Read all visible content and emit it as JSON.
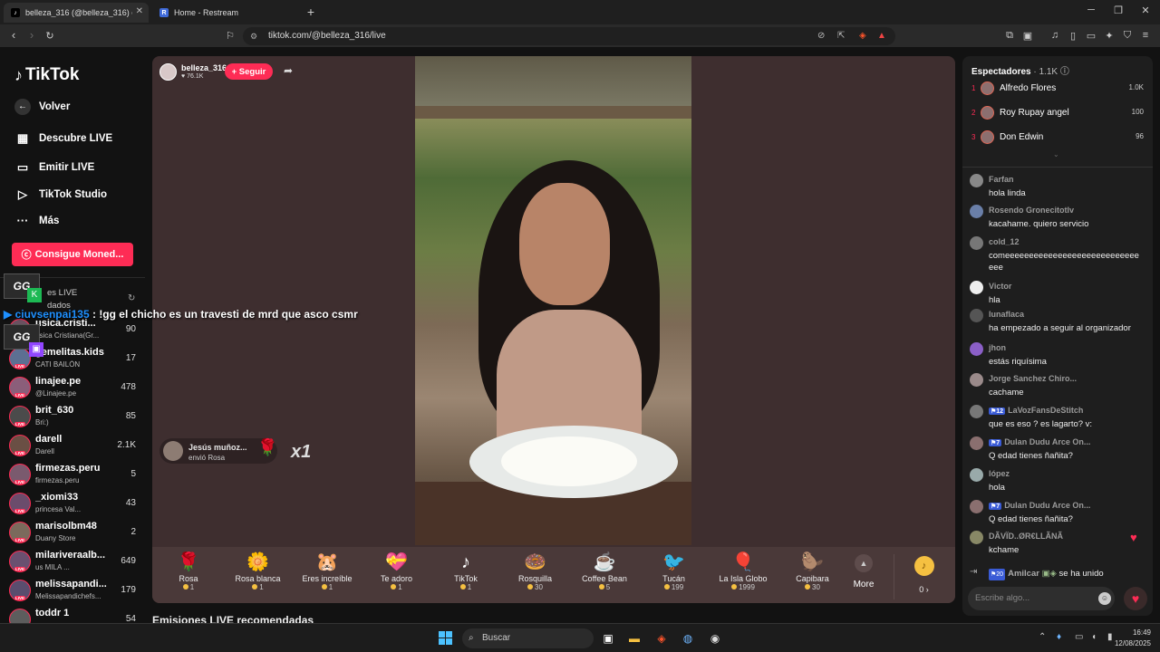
{
  "browser": {
    "tabs": [
      {
        "title": "belleza_316 (@belleza_316) e",
        "active": true
      },
      {
        "title": "Home - Restream",
        "active": false
      }
    ],
    "url": "tiktok.com/@belleza_316/live"
  },
  "nav": {
    "logo": "TikTok",
    "back": "Volver",
    "items": [
      "Descubre LIVE",
      "Emitir LIVE",
      "TikTok Studio",
      "Más"
    ],
    "coins_button": "Consigue Moned...",
    "section_title_partial": "es LIVE",
    "section_sub_partial": "dados"
  },
  "channels": [
    {
      "name": "usica.cristi...",
      "sub": "usica Cristiana(Gr...",
      "count": "90"
    },
    {
      "name": "gemelitas.kids",
      "sub": "CATI BAILÓN",
      "count": "17"
    },
    {
      "name": "linajee.pe",
      "sub": "@Linajee.pe",
      "count": "478"
    },
    {
      "name": "brit_630",
      "sub": "Bri:)",
      "count": "85"
    },
    {
      "name": "darell",
      "sub": "Darell",
      "count": "2.1K"
    },
    {
      "name": "firmezas.peru",
      "sub": "firmezas.peru",
      "count": "5"
    },
    {
      "name": "_xiomi33",
      "sub": "princesa Val...",
      "count": "43"
    },
    {
      "name": "marisolbm48",
      "sub": "Duany Store",
      "count": "2"
    },
    {
      "name": "milariveraalb...",
      "sub": "us MILA ...",
      "count": "649"
    },
    {
      "name": "melissapandi...",
      "sub": "Melissapandichefs...",
      "count": "179"
    },
    {
      "name": "toddr 1",
      "sub": "",
      "count": "54"
    }
  ],
  "live_badge": "LIVE",
  "streamer": {
    "name": "belleza_316",
    "likes": "76.1K",
    "follow": "+ Seguir"
  },
  "gift_notice": {
    "user": "Jesús muñoz...",
    "text": "envió Rosa",
    "multiplier": "x1"
  },
  "overlay": {
    "badge": "GG",
    "username": "ciuvsenpai135",
    "message": ": !gg el chicho es un travesti de mrd que asco csmr"
  },
  "gifts": [
    {
      "name": "Rosa",
      "price": "1",
      "icon": "🌹"
    },
    {
      "name": "Rosa blanca",
      "price": "1",
      "icon": "🌼"
    },
    {
      "name": "Eres increíble",
      "price": "1",
      "icon": "🐹"
    },
    {
      "name": "Te adoro",
      "price": "1",
      "icon": "💝"
    },
    {
      "name": "TikTok",
      "price": "1",
      "icon": "♪"
    },
    {
      "name": "Rosquilla",
      "price": "30",
      "icon": "🍩"
    },
    {
      "name": "Coffee Bean",
      "price": "5",
      "icon": "☕"
    },
    {
      "name": "Tucán",
      "price": "199",
      "icon": "🐦"
    },
    {
      "name": "La Isla Globo",
      "price": "1999",
      "icon": "🎈"
    },
    {
      "name": "Capibara",
      "price": "30",
      "icon": "🦫"
    }
  ],
  "more": "More",
  "coin_balance": "0 ›",
  "recommended": "Emisiones LIVE recomendadas",
  "viewers": {
    "title": "Espectadores",
    "count": "· 1.1K",
    "top": [
      {
        "rank": "1",
        "name": "Alfredo Flores",
        "score": "1.0K"
      },
      {
        "rank": "2",
        "name": "Roy Rupay angel",
        "score": "100"
      },
      {
        "rank": "3",
        "name": "Don Edwin",
        "score": "96"
      }
    ]
  },
  "comments": [
    {
      "user": "Farfan",
      "text": "hola linda"
    },
    {
      "user": "Rosendo Gronecitotlv",
      "text": "kacahame. quiero servicio"
    },
    {
      "user": "cold_12",
      "text": "comeeeeeeeeeeeeeeeeeeeeeeeeeeee eee"
    },
    {
      "user": "Victor",
      "text": "hla"
    },
    {
      "user": "lunaflaca",
      "text": "ha empezado a seguir al organizador"
    },
    {
      "user": "jhon",
      "text": "estás riquísima"
    },
    {
      "user": "Jorge Sanchez Chiro...",
      "text": "cachame"
    },
    {
      "user": "LaVozFansDeStitch",
      "level": "12",
      "text": "que es eso ? es lagarto? v:"
    },
    {
      "user": "Dulan Dudu Arce On...",
      "level": "7",
      "text": "Q edad tienes ñañita?"
    },
    {
      "user": "lópez",
      "text": "hola"
    },
    {
      "user": "Dulan Dudu Arce On...",
      "level": "7",
      "text": "Q edad tienes ñañita?"
    },
    {
      "user": "DÃVÏD..ØR€LLÃNÃ",
      "text": "kchame"
    }
  ],
  "joined": {
    "level": "20",
    "user": "Amilcar",
    "text": "se ha unido"
  },
  "chat_placeholder": "Escribe algo...",
  "taskbar": {
    "search": "Buscar",
    "time": "16:49",
    "date": "12/08/2025"
  }
}
